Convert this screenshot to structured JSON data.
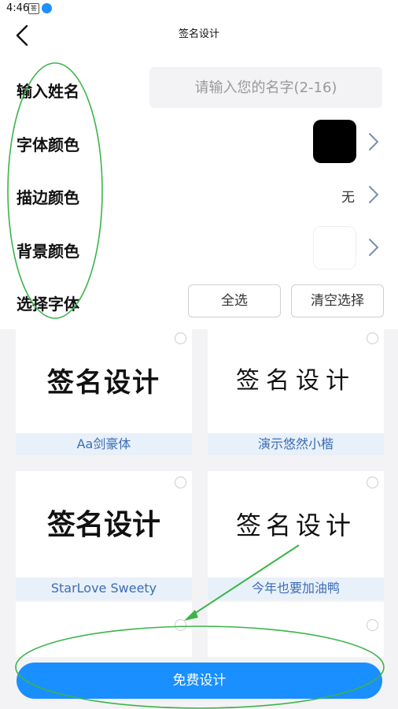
{
  "status_bar": {
    "time": "4:46"
  },
  "nav": {
    "title": "签名设计"
  },
  "form": {
    "name_label": "输入姓名",
    "name_placeholder": "请输入您的名字(2-16)",
    "font_color_label": "字体颜色",
    "font_color_value": "#000000",
    "stroke_color_label": "描边颜色",
    "stroke_color_value": "无",
    "bg_color_label": "背景颜色",
    "bg_color_value": "#ffffff",
    "font_select_label": "选择字体",
    "select_all": "全选",
    "clear_selection": "清空选择"
  },
  "fonts": [
    {
      "caption": "Aa剑豪体",
      "preview": "签名设计"
    },
    {
      "caption": "演示悠然小楷",
      "preview": "签名设计"
    },
    {
      "caption": "StarLove Sweety",
      "preview": "签名设计"
    },
    {
      "caption": "今年也要加油鸭",
      "preview": "签名设计"
    }
  ],
  "primary_button": {
    "label": "免费设计"
  },
  "colors": {
    "accent": "#1a8fff",
    "annotation": "#3cb44b"
  }
}
